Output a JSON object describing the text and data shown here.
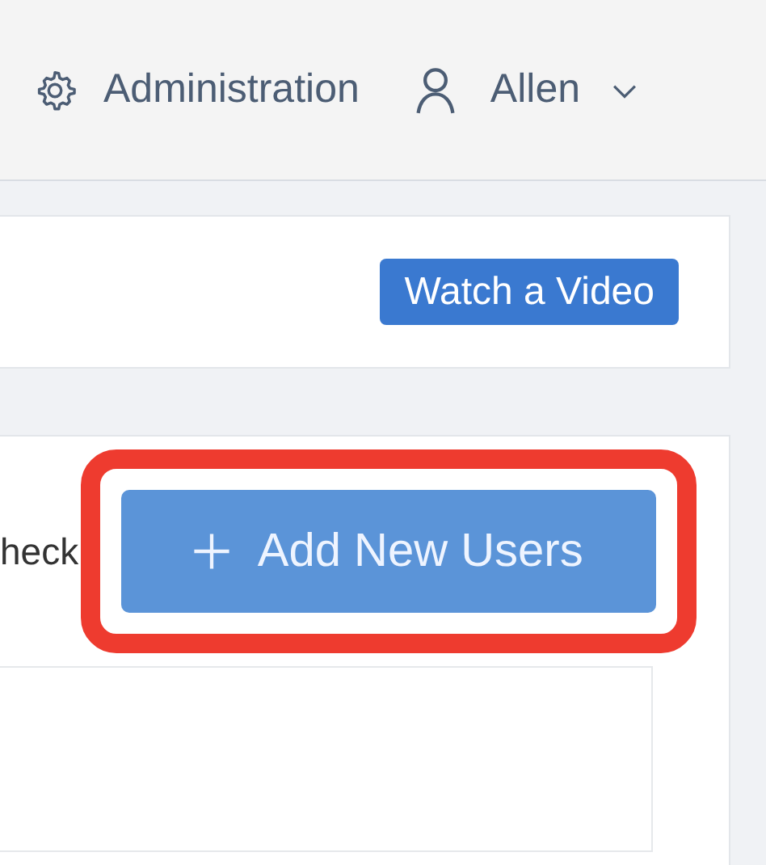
{
  "header": {
    "admin_link": "Administration",
    "user_menu": {
      "name": "Allen",
      "expanded": false
    }
  },
  "video_panel": {
    "button": "Watch a Video"
  },
  "users_panel": {
    "toolbar_text": "heck",
    "add_button": {
      "label": "Add New Users",
      "highlighted": true
    }
  }
}
